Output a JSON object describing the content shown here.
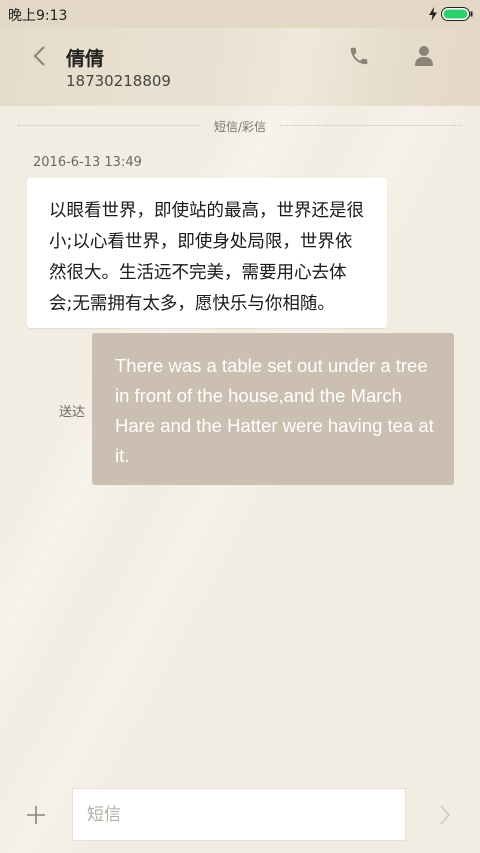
{
  "status_bar": {
    "time": "晚上9:13",
    "battery_color": "#2bd26b"
  },
  "header": {
    "contact_name": "倩倩",
    "phone_number": "18730218809"
  },
  "thread": {
    "divider_label": "短信/彩信",
    "timestamp": "2016-6-13 13:49",
    "received_message": "以眼看世界，即使站的最高，世界还是很小;以心看世界，即使身处局限，世界依然很大。生活远不完美，需要用心去体会;无需拥有太多，愿快乐与你相随。",
    "sent_status": "送达",
    "sent_message": "There was a table set out under a tree in front of the house,and the March Hare and the Hatter were having tea at it."
  },
  "compose": {
    "placeholder": "短信"
  }
}
